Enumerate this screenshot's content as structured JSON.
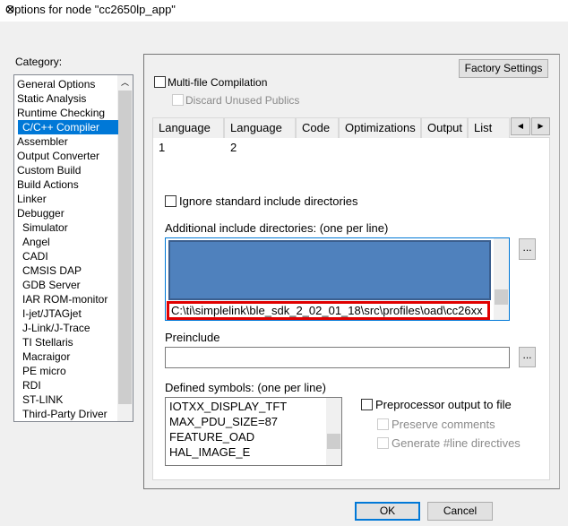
{
  "window": {
    "title": "Options for node \"cc2650lp_app\"",
    "close_icon": "close-icon"
  },
  "category": {
    "label": "Category:",
    "items": [
      {
        "label": "General Options",
        "sub": false
      },
      {
        "label": "Static Analysis",
        "sub": false
      },
      {
        "label": "Runtime Checking",
        "sub": false
      },
      {
        "label": "C/C++ Compiler",
        "sub": false,
        "selected": true
      },
      {
        "label": "Assembler",
        "sub": false
      },
      {
        "label": "Output Converter",
        "sub": false
      },
      {
        "label": "Custom Build",
        "sub": false
      },
      {
        "label": "Build Actions",
        "sub": false
      },
      {
        "label": "Linker",
        "sub": false
      },
      {
        "label": "Debugger",
        "sub": false
      },
      {
        "label": "Simulator",
        "sub": true
      },
      {
        "label": "Angel",
        "sub": true
      },
      {
        "label": "CADI",
        "sub": true
      },
      {
        "label": "CMSIS DAP",
        "sub": true
      },
      {
        "label": "GDB Server",
        "sub": true
      },
      {
        "label": "IAR ROM-monitor",
        "sub": true
      },
      {
        "label": "I-jet/JTAGjet",
        "sub": true
      },
      {
        "label": "J-Link/J-Trace",
        "sub": true
      },
      {
        "label": "TI Stellaris",
        "sub": true
      },
      {
        "label": "Macraigor",
        "sub": true
      },
      {
        "label": "PE micro",
        "sub": true
      },
      {
        "label": "RDI",
        "sub": true
      },
      {
        "label": "ST-LINK",
        "sub": true
      },
      {
        "label": "Third-Party Driver",
        "sub": true
      }
    ]
  },
  "factory_settings": "Factory Settings",
  "multi_file": {
    "label": "Multi-file Compilation",
    "checked": false
  },
  "discard_unused": {
    "label": "Discard Unused Publics",
    "checked": false,
    "enabled": false
  },
  "tabs": [
    "Language 1",
    "Language 2",
    "Code",
    "Optimizations",
    "Output",
    "List"
  ],
  "ignore_std": {
    "label": "Ignore standard include directories",
    "checked": false
  },
  "include_dirs": {
    "label": "Additional include directories: (one per line)",
    "last_line": "C:\\ti\\simplelink\\ble_sdk_2_02_01_18\\src\\profiles\\oad\\cc26xx",
    "browse": "..."
  },
  "preinclude": {
    "label": "Preinclude",
    "value": "",
    "browse": "..."
  },
  "defined_symbols": {
    "label": "Defined symbols: (one per line)",
    "lines": [
      "IOTXX_DISPLAY_TFT",
      "MAX_PDU_SIZE=87",
      "FEATURE_OAD",
      "HAL_IMAGE_E"
    ]
  },
  "preproc": {
    "label": "Preprocessor output to file",
    "checked": false,
    "preserve": "Preserve comments",
    "generate": "Generate #line directives"
  },
  "ok": "OK",
  "cancel": "Cancel",
  "colors": {
    "selection": "#0078d7",
    "highlight_block": "#4f81bd",
    "annotation_box": "#e00000"
  }
}
